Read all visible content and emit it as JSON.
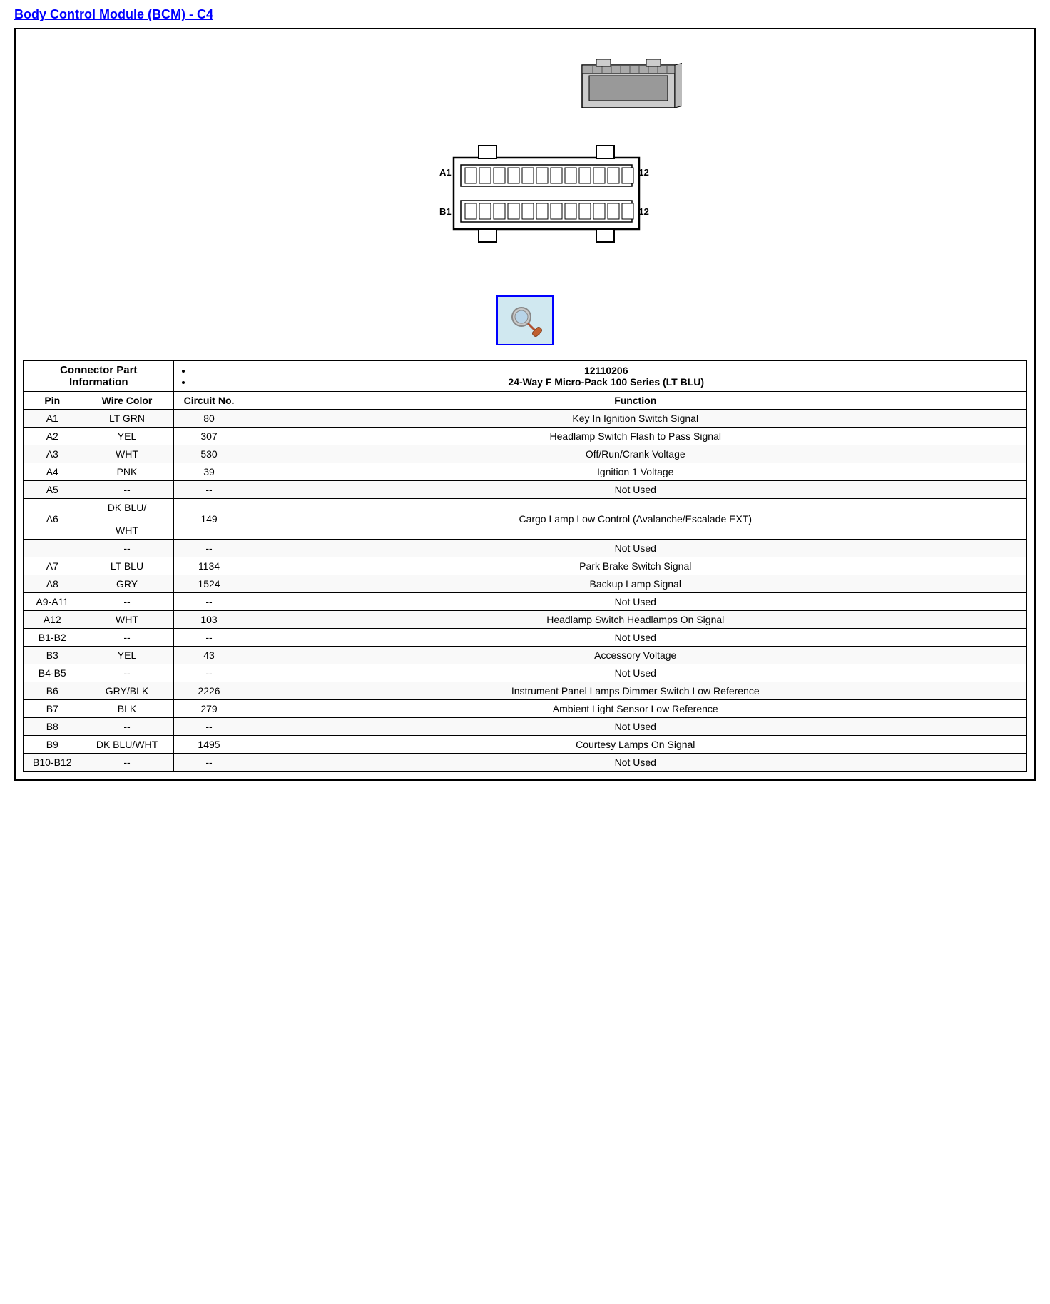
{
  "title": "Body Control Module (BCM) - C4",
  "connector_part_info_label": "Connector Part Information",
  "connector_details": [
    "12110206",
    "24-Way F Micro-Pack 100 Series (LT BLU)"
  ],
  "table_headers": {
    "pin": "Pin",
    "wire_color": "Wire Color",
    "circuit_no": "Circuit No.",
    "function": "Function"
  },
  "rows": [
    {
      "pin": "A1",
      "wire_color": "LT GRN",
      "circuit": "80",
      "function": "Key In Ignition Switch Signal"
    },
    {
      "pin": "A2",
      "wire_color": "YEL",
      "circuit": "307",
      "function": "Headlamp Switch Flash to Pass Signal"
    },
    {
      "pin": "A3",
      "wire_color": "WHT",
      "circuit": "530",
      "function": "Off/Run/Crank Voltage"
    },
    {
      "pin": "A4",
      "wire_color": "PNK",
      "circuit": "39",
      "function": "Ignition 1 Voltage"
    },
    {
      "pin": "A5",
      "wire_color": "--",
      "circuit": "--",
      "function": "Not Used"
    },
    {
      "pin": "A6",
      "wire_color": "DK BLU/\n\nWHT",
      "circuit": "149",
      "function": "Cargo Lamp Low Control (Avalanche/Escalade EXT)",
      "multiline_wire": true
    },
    {
      "pin": "",
      "wire_color": "--",
      "circuit": "--",
      "function": "Not Used",
      "empty_pin": true
    },
    {
      "pin": "A7",
      "wire_color": "LT BLU",
      "circuit": "1134",
      "function": "Park Brake Switch Signal"
    },
    {
      "pin": "A8",
      "wire_color": "GRY",
      "circuit": "1524",
      "function": "Backup Lamp Signal"
    },
    {
      "pin": "A9-A11",
      "wire_color": "--",
      "circuit": "--",
      "function": "Not Used"
    },
    {
      "pin": "A12",
      "wire_color": "WHT",
      "circuit": "103",
      "function": "Headlamp Switch Headlamps On Signal"
    },
    {
      "pin": "B1-B2",
      "wire_color": "--",
      "circuit": "--",
      "function": "Not Used"
    },
    {
      "pin": "B3",
      "wire_color": "YEL",
      "circuit": "43",
      "function": "Accessory Voltage"
    },
    {
      "pin": "B4-B5",
      "wire_color": "--",
      "circuit": "--",
      "function": "Not Used"
    },
    {
      "pin": "B6",
      "wire_color": "GRY/BLK",
      "circuit": "2226",
      "function": "Instrument Panel Lamps Dimmer Switch Low Reference"
    },
    {
      "pin": "B7",
      "wire_color": "BLK",
      "circuit": "279",
      "function": "Ambient Light Sensor Low Reference"
    },
    {
      "pin": "B8",
      "wire_color": "--",
      "circuit": "--",
      "function": "Not Used"
    },
    {
      "pin": "B9",
      "wire_color": "DK BLU/WHT",
      "circuit": "1495",
      "function": "Courtesy Lamps On Signal"
    },
    {
      "pin": "B10-B12",
      "wire_color": "--",
      "circuit": "--",
      "function": "Not Used"
    }
  ]
}
